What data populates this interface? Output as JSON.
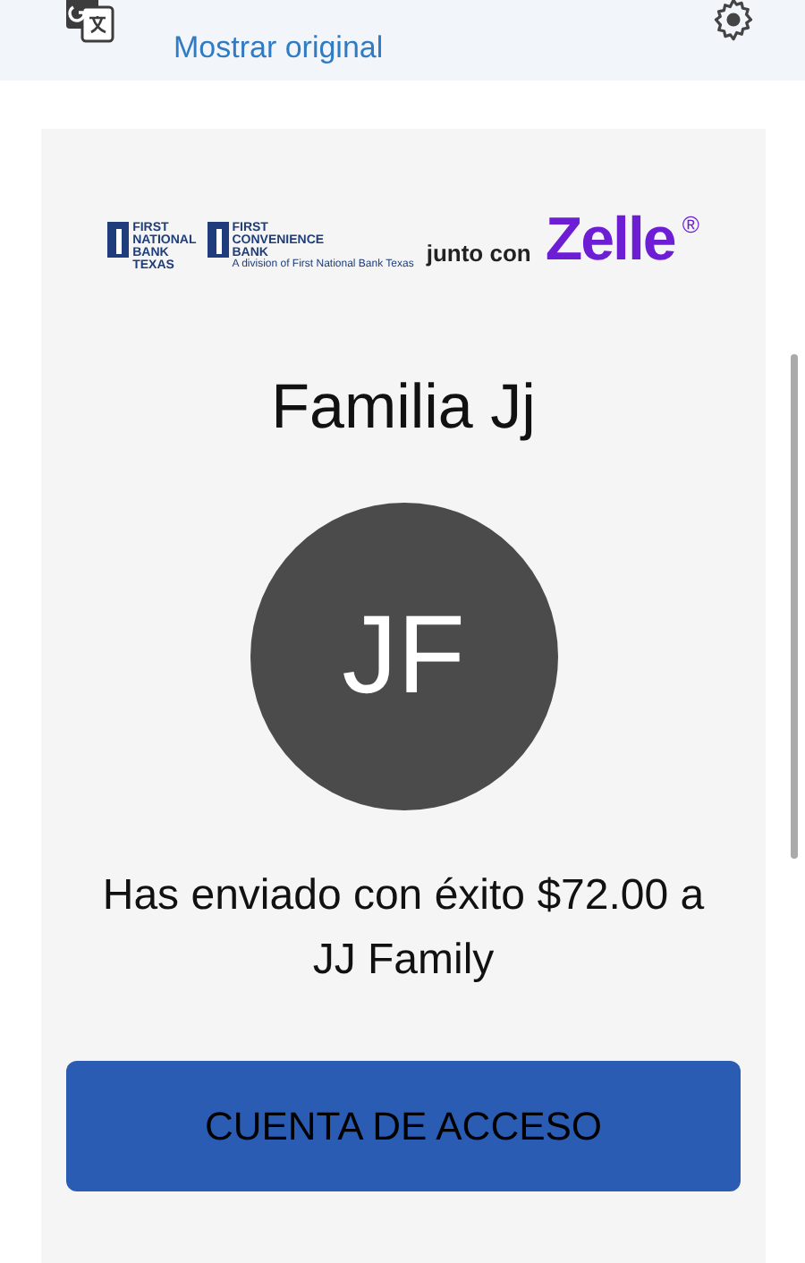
{
  "translate_bar": {
    "link": "Mostrar original"
  },
  "brand": {
    "bank_1": [
      "FIRST",
      "NATIONAL",
      "BANK",
      "TEXAS"
    ],
    "bank_2": [
      "FIRST",
      "CONVENIENCE",
      "BANK"
    ],
    "bank_2_note": "A division of First National Bank Texas",
    "joiner": "junto con",
    "partner": "Zelle",
    "partner_mark": "®"
  },
  "recipient": {
    "name": "Familia Jj",
    "initials": "JF"
  },
  "message": "Has enviado con éxito $72.00 a JJ Family",
  "button": "CUENTA DE ACCESO"
}
